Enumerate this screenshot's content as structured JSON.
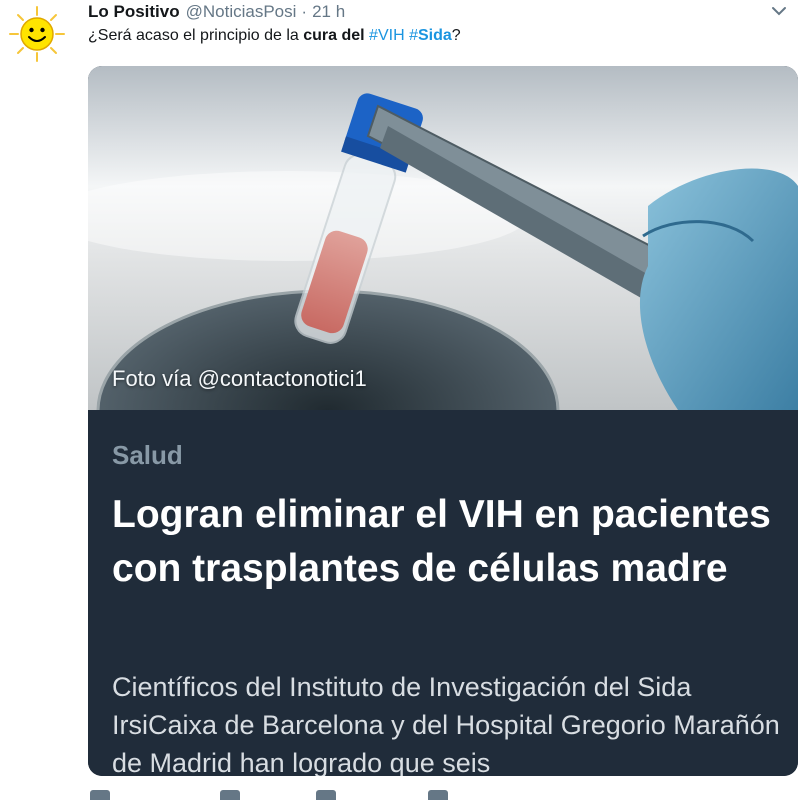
{
  "tweet": {
    "author_name": "Lo Positivo",
    "author_handle": "@NoticiasPosi",
    "separator": "·",
    "time": "21 h",
    "text_prefix": "¿Será acaso el principio de la ",
    "text_bold": "cura del",
    "text_space": " ",
    "hashtag_1": "#VIH",
    "hashtag_2_symbol": "#",
    "hashtag_2_word": "Sida",
    "text_suffix": "?"
  },
  "card": {
    "image_credit": "Foto vía @contactonotici1",
    "category": "Salud",
    "title": "Logran eliminar el VIH en pacientes con trasplantes de células madre",
    "description": "Científicos del Instituto de Investigación del Sida IrsiCaixa de Barcelona y del Hospital Gregorio Marañón de Madrid han logrado que seis"
  },
  "icons": {
    "avatar": "smiling-sun-icon",
    "menu": "chevron-down-icon",
    "actions": [
      "reply-icon",
      "retweet-icon",
      "like-icon",
      "share-icon"
    ]
  },
  "colors": {
    "link": "#1b95e0",
    "secondary_text": "#657786",
    "card_background": "#202c3a"
  }
}
